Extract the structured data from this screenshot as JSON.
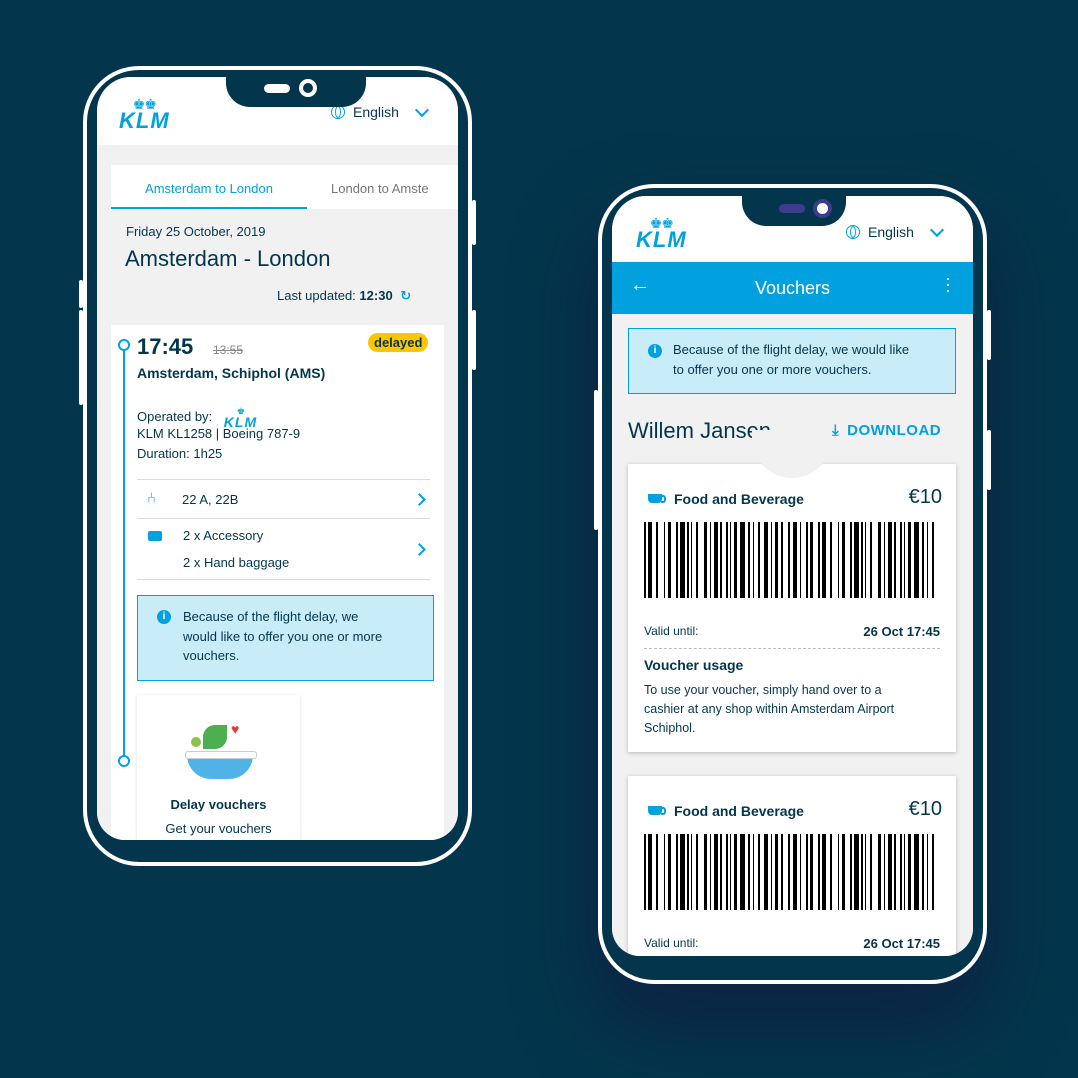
{
  "phone_left": {
    "language": "English",
    "tabs": [
      {
        "label": "Amsterdam to London",
        "active": true
      },
      {
        "label": "London to Amste",
        "active": false
      }
    ],
    "flight_date": "Friday 25 October, 2019",
    "route_title": "Amsterdam - London",
    "last_updated_label": "Last updated:",
    "last_updated_time": "12:30",
    "new_time": "17:45",
    "old_time": "13:55",
    "status_badge": "delayed",
    "departure_airport": "Amsterdam, Schiphol (AMS)",
    "operated_by_label": "Operated by:",
    "flight_info": "KLM KL1258 | Boeing 787-9",
    "duration": "Duration: 1h25",
    "seats": "22 A, 22B",
    "baggage": [
      "2 x Accessory",
      "2 x Hand baggage"
    ],
    "info_message": [
      "Because of the flight delay, we",
      "would like to offer you one or more",
      "vouchers."
    ],
    "voucher_card_title": "Delay vouchers",
    "voucher_card_subtitle": "Get your vouchers"
  },
  "phone_right": {
    "language": "English",
    "app_bar_title": "Vouchers",
    "info_message": [
      "Because of the flight delay, we would like",
      "to offer you one or more vouchers."
    ],
    "passenger_name": "Willem Jansen",
    "download_label": "DOWNLOAD",
    "vouchers": [
      {
        "category": "Food and Beverage",
        "amount": "€10",
        "valid_label": "Valid until:",
        "valid_value": "26 Oct 17:45"
      },
      {
        "category": "Food and Beverage",
        "amount": "€10",
        "valid_label": "Valid until:",
        "valid_value": "26 Oct 17:45"
      }
    ],
    "usage_title": "Voucher usage",
    "usage_text": [
      "To use your voucher, simply hand over to a",
      "cashier at any shop within Amsterdam Airport",
      "Schiphol."
    ]
  },
  "brand": {
    "logo_text": "KLM",
    "accent": "#00a1de",
    "navy": "#03364c",
    "badge": "#ffc600",
    "info_bg": "#c8ecf8"
  }
}
